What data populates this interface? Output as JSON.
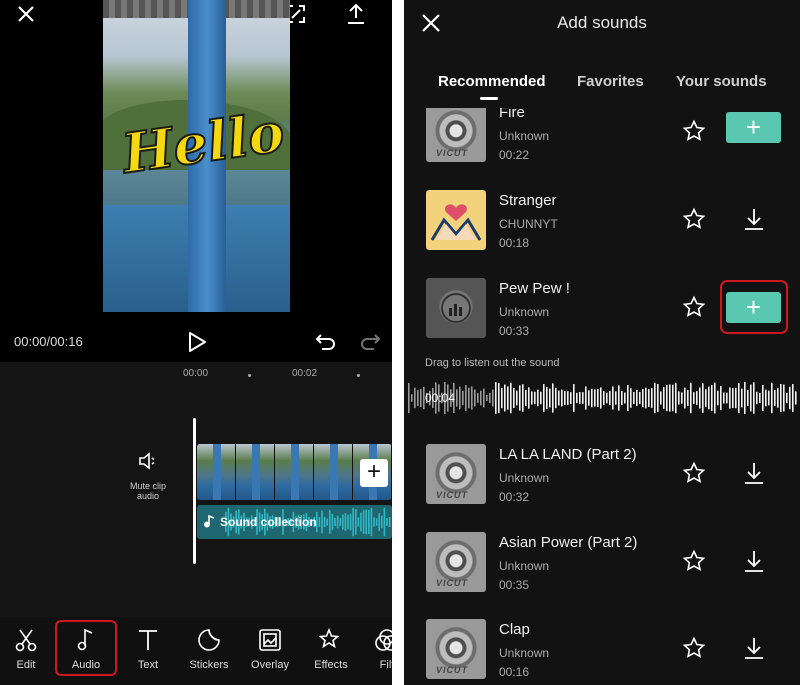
{
  "editor": {
    "time_display": "00:00/00:16",
    "ruler": [
      "00:00",
      "00:02"
    ],
    "mute_label": "Mute clip audio",
    "audio_track_label": "Sound collection",
    "overlay_text": "Hello",
    "toolbar": [
      {
        "label": "Edit",
        "icon": "scissors-icon"
      },
      {
        "label": "Audio",
        "icon": "music-note-icon",
        "highlighted": true
      },
      {
        "label": "Text",
        "icon": "text-icon"
      },
      {
        "label": "Stickers",
        "icon": "sticker-icon"
      },
      {
        "label": "Overlay",
        "icon": "overlay-icon"
      },
      {
        "label": "Effects",
        "icon": "effects-icon"
      },
      {
        "label": "Filt",
        "icon": "filter-icon"
      }
    ]
  },
  "add_sounds": {
    "title": "Add sounds",
    "tabs": [
      "Recommended",
      "Favorites",
      "Your sounds"
    ],
    "active_tab": "Recommended",
    "drag_hint": "Drag to listen out the sound",
    "playback_time": "00:04",
    "sounds": [
      {
        "title": "Fire",
        "artist": "Unknown",
        "duration": "00:22",
        "action": "add",
        "cover_text": "VICUT"
      },
      {
        "title": "Stranger",
        "artist": "CHUNNYT",
        "duration": "00:18",
        "action": "download"
      },
      {
        "title": "Pew Pew !",
        "artist": "Unknown",
        "duration": "00:33",
        "action": "add"
      },
      {
        "title": "LA LA LAND (Part 2)",
        "artist": "Unknown",
        "duration": "00:32",
        "action": "download",
        "cover_text": "VICUT"
      },
      {
        "title": "Asian Power (Part 2)",
        "artist": "Unknown",
        "duration": "00:35",
        "action": "download",
        "cover_text": "VICUT"
      },
      {
        "title": "Clap",
        "artist": "Unknown",
        "duration": "00:16",
        "action": "download",
        "cover_text": "VICUT"
      }
    ]
  },
  "colors": {
    "accent": "#5ac8b0",
    "highlight": "#d0161f",
    "audio_track": "#1e6670"
  }
}
